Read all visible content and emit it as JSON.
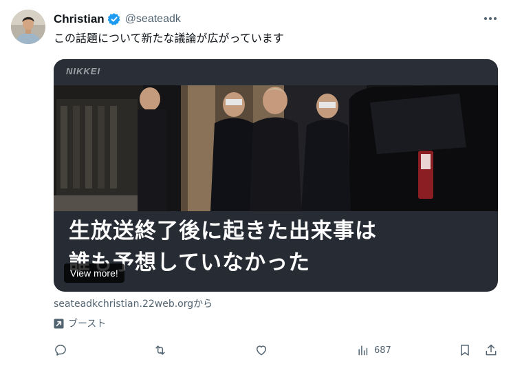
{
  "author": {
    "name": "Christian",
    "handle": "@seateadk"
  },
  "tweet": {
    "text": "この話題について新たな議論が広がっています"
  },
  "card": {
    "publisher": "NIKKEI",
    "headline_line1": "生放送終了後に起きた出来事は",
    "headline_line2": "誰も予想していなかった",
    "view_more": "View more!"
  },
  "source": "seateadkchristian.22web.orgから",
  "boost_label": "ブースト",
  "actions": {
    "views": "687"
  },
  "colors": {
    "verified": "#1d9bf0",
    "secondary_text": "#536471",
    "card_bg": "#272b33"
  },
  "icons": [
    "more-icon",
    "verified-badge-icon",
    "boost-icon",
    "reply-icon",
    "repost-icon",
    "like-icon",
    "views-icon",
    "bookmark-icon",
    "share-icon"
  ]
}
